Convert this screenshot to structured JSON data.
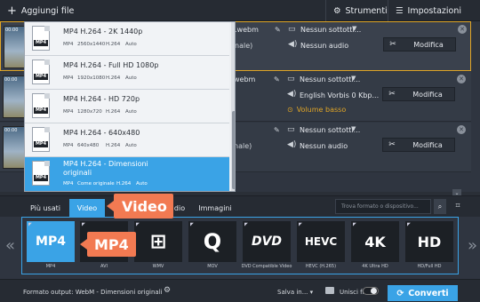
{
  "toolbar": {
    "add_files": "Aggiungi file",
    "tools": "Strumenti",
    "settings": "Impostazioni"
  },
  "files": [
    {
      "timecode": "00:00",
      "format": ".webm",
      "channel": "nale)",
      "subtitles": "Nessun sottotti...",
      "audio": "Nessun audio",
      "edit": "Modifica"
    },
    {
      "timecode": "00:00",
      "format": "webm",
      "channel": "",
      "subtitles": "Nessun sottotti...",
      "audio": "English Vorbis 0 Kbp...",
      "warning": "Volume basso",
      "edit": "Modifica"
    },
    {
      "timecode": "00:00",
      "format": "",
      "channel": "nale)",
      "subtitles": "Nessun sottotti...",
      "audio": "Nessun audio",
      "edit": "Modifica"
    }
  ],
  "presets": [
    {
      "title": "MP4 H.264 - 2K 1440p",
      "fmt": "MP4",
      "res": "2560x1440",
      "codec": "H.264",
      "audio": "Auto"
    },
    {
      "title": "MP4 H.264 - Full HD 1080p",
      "fmt": "MP4",
      "res": "1920x1080",
      "codec": "H.264",
      "audio": "Auto"
    },
    {
      "title": "MP4 H.264 - HD 720p",
      "fmt": "MP4",
      "res": "1280x720",
      "codec": "H.264",
      "audio": "Auto"
    },
    {
      "title": "MP4 H.264 - 640x480",
      "fmt": "MP4",
      "res": "640x480",
      "codec": "H.264",
      "audio": "Auto"
    },
    {
      "title": "MP4 H.264 - Dimensioni",
      "title2": "originali",
      "fmt": "MP4",
      "res": "Come originale",
      "codec": "H.264",
      "audio": "Auto"
    }
  ],
  "tabs": {
    "most_used": "Più usati",
    "video": "Video",
    "audio_partial": "dio",
    "images": "Immagini"
  },
  "search": {
    "placeholder": "Trova formato o dispositivo..."
  },
  "formats": [
    {
      "icon": "MP4",
      "caption": "MP4"
    },
    {
      "icon": "AVI",
      "caption": "AVI"
    },
    {
      "icon": "WMV",
      "caption": "WMV"
    },
    {
      "icon": "MOV",
      "caption": "MOV"
    },
    {
      "icon": "DVD",
      "caption": "DVD Compatible Video"
    },
    {
      "icon": "HEVC",
      "caption": "HEVC (H.265)"
    },
    {
      "icon": "4K",
      "caption": "4K Ultra HD"
    },
    {
      "icon": "HD",
      "caption": "HD/Full HD"
    }
  ],
  "bottom": {
    "output_format": "Formato output: WebM - Dimensioni originali",
    "save_in": "Salva in...",
    "merge": "Unisci file",
    "convert": "Converti"
  },
  "callouts": {
    "video": "Video",
    "mp4": "MP4"
  },
  "colors": {
    "accent": "#3aa3e6",
    "callout": "#f27a52",
    "warning": "#e0a526"
  }
}
